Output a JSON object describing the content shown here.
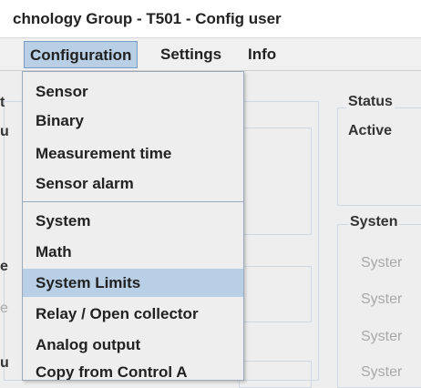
{
  "window": {
    "title": "chnology Group - T501 - Config user"
  },
  "menubar": {
    "items": [
      "Configuration",
      "Settings",
      "Info"
    ]
  },
  "dropdown": {
    "items": [
      "Sensor",
      "Binary",
      "Measurement time",
      "Sensor alarm",
      "System",
      "Math",
      "System Limits",
      "Relay / Open collector",
      "Analog output",
      "Copy from Control A"
    ],
    "selected": "System Limits"
  },
  "background": {
    "left_edge_chars": [
      "t",
      "u",
      "e",
      "e",
      "u"
    ],
    "status_label": "Status",
    "active_label": "Active",
    "system_group_label": "Systen",
    "system_items": [
      "Syster",
      "Syster",
      "Syster",
      "Syster"
    ]
  },
  "colors": {
    "highlight": "#b8cfe5",
    "menu_border": "#7a9cc2",
    "separator": "#9aa9bb"
  }
}
